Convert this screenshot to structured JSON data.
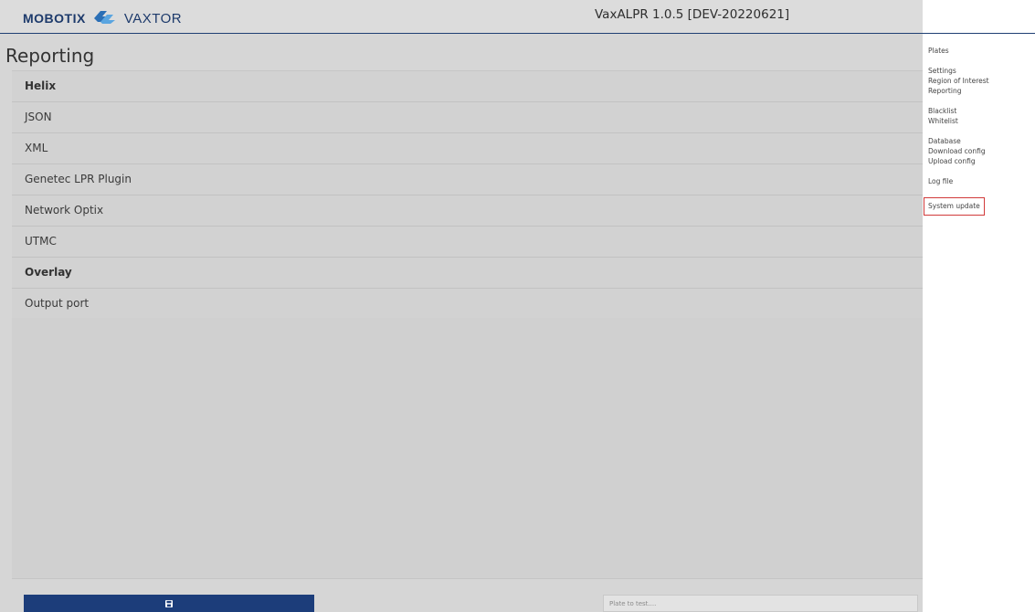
{
  "header": {
    "brand_mobotix": "MOBOTIX",
    "brand_vaxtor": "VAXTOR",
    "app_title": "VaxALPR 1.0.5 [DEV-20220621]",
    "logo_colors": {
      "primary": "#2b6fb5",
      "secondary": "#5aa5e0"
    }
  },
  "main": {
    "page_title": "Reporting",
    "sections": [
      {
        "label": "Helix",
        "bold": true
      },
      {
        "label": "JSON",
        "bold": false
      },
      {
        "label": "XML",
        "bold": false
      },
      {
        "label": "Genetec LPR Plugin",
        "bold": false
      },
      {
        "label": "Network Optix",
        "bold": false
      },
      {
        "label": "UTMC",
        "bold": false
      },
      {
        "label": "Overlay",
        "bold": true
      },
      {
        "label": "Output port",
        "bold": false
      }
    ],
    "save_button": {
      "icon": "floppy-disk-icon",
      "color": "#1c3d7a"
    },
    "plate_input": {
      "value": "",
      "placeholder": "Plate to test...."
    }
  },
  "sidebar": {
    "groups": [
      [
        "Plates"
      ],
      [
        "Settings",
        "Region of Interest",
        "Reporting"
      ],
      [
        "Blacklist",
        "Whitelist"
      ],
      [
        "Database",
        "Download config",
        "Upload config"
      ],
      [
        "Log file"
      ],
      [
        "System update"
      ]
    ],
    "highlighted": "System update",
    "highlight_color": "#d13a3a"
  }
}
